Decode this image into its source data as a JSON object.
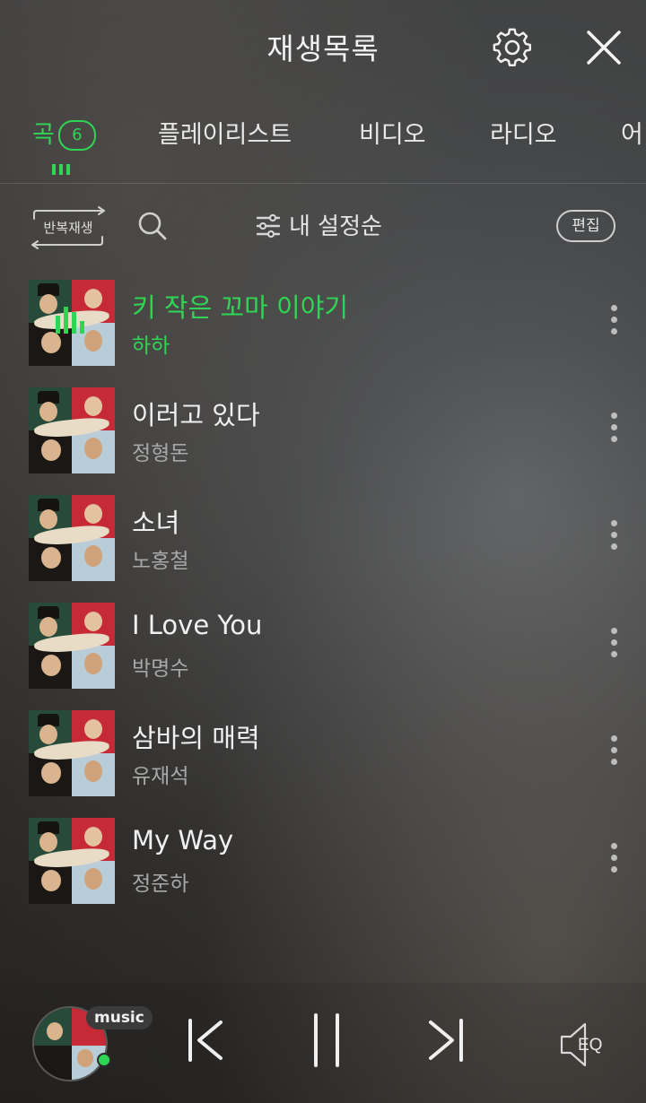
{
  "header": {
    "title": "재생목록"
  },
  "tabs": [
    {
      "label": "곡",
      "count": "6",
      "active": true
    },
    {
      "label": "플레이리스트"
    },
    {
      "label": "비디오"
    },
    {
      "label": "라디오"
    },
    {
      "label": "어"
    }
  ],
  "toolbar": {
    "repeat_label": "반복재생",
    "sort_label": "내 설정순",
    "edit_label": "편집"
  },
  "songs": [
    {
      "title": "키 작은 꼬마 이야기",
      "artist": "하하",
      "playing": true
    },
    {
      "title": "이러고 있다",
      "artist": "정형돈"
    },
    {
      "title": "소녀",
      "artist": "노홍철"
    },
    {
      "title": "I Love You",
      "artist": "박명수"
    },
    {
      "title": "삼바의 매력",
      "artist": "유재석"
    },
    {
      "title": "My Way",
      "artist": "정준하"
    }
  ],
  "player": {
    "badge": "music",
    "eq_label": "EQ",
    "state": "playing"
  },
  "colors": {
    "accent": "#2fd654",
    "text": "#f0f0f0",
    "subtext": "#a8a8a8"
  },
  "icons": [
    "settings-icon",
    "close-icon",
    "repeat-icon",
    "search-icon",
    "sort-sliders-icon",
    "more-vertical-icon",
    "previous-icon",
    "pause-icon",
    "next-icon",
    "eq-speaker-icon"
  ]
}
